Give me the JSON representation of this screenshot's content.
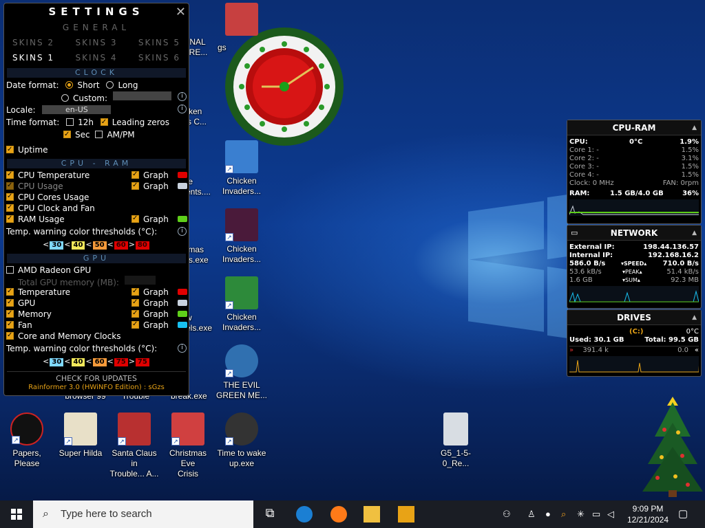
{
  "settings": {
    "title": "SETTINGS",
    "general_tab": "GENERAL",
    "skins_row1": [
      "SKINS 2",
      "SKINS 3",
      "SKINS 5"
    ],
    "skins_row2": [
      "SKINS 1",
      "SKINS 4",
      "SKINS 6"
    ],
    "clock_header": "CLOCK",
    "date_format_label": "Date format:",
    "date_short": "Short",
    "date_long": "Long",
    "date_custom": "Custom:",
    "locale_label": "Locale:",
    "locale_value": "en-US",
    "time_format_label": "Time format:",
    "time_12h": "12h",
    "time_leading_zeros": "Leading zeros",
    "time_sec": "Sec",
    "time_ampm": "AM/PM",
    "uptime": "Uptime",
    "cpu_ram_header": "CPU - RAM",
    "cpu_temperature": "CPU Temperature",
    "cpu_usage": "CPU Usage",
    "cpu_cores_usage": "CPU Cores Usage",
    "cpu_clock_fan": "CPU Clock and Fan",
    "ram_usage": "RAM Usage",
    "graph_label": "Graph",
    "temp_thresholds_label": "Temp. warning color thresholds (°C):",
    "cpu_thresholds": [
      "30",
      "40",
      "50",
      "60",
      "80"
    ],
    "gpu_header": "GPU",
    "gpu_name": "AMD Radeon GPU",
    "gpu_total_memory": "Total GPU memory (MB):",
    "gpu_temperature": "Temperature",
    "gpu_gpu": "GPU",
    "gpu_memory": "Memory",
    "gpu_fan": "Fan",
    "gpu_core_mem_clocks": "Core and Memory Clocks",
    "gpu_thresholds": [
      "30",
      "40",
      "60",
      "75",
      "75"
    ],
    "check_updates": "CHECK FOR UPDATES",
    "footer": "Rainformer 3.0 (HWiNFO Edition) : sGzs",
    "swatch_colors": {
      "cpu_temp": "#e00000",
      "cpu_usage": "#c9d2de",
      "ram_usage": "#5fcf1a",
      "gpu_temp": "#e00000",
      "gpu_gpu": "#c9d2de",
      "gpu_memory": "#5fcf1a",
      "gpu_fan": "#18c0f0"
    }
  },
  "cpu_ram_gadget": {
    "title": "CPU-RAM",
    "cpu_label": "CPU:",
    "cpu_temp": "0°C",
    "cpu_pct": "1.9%",
    "cores": [
      {
        "label": "Core 1:",
        "dash": "-",
        "value": "1.5%"
      },
      {
        "label": "Core 2:",
        "dash": "-",
        "value": "3.1%"
      },
      {
        "label": "Core 3:",
        "dash": "-",
        "value": "1.5%"
      },
      {
        "label": "Core 4:",
        "dash": "-",
        "value": "1.5%"
      }
    ],
    "clock": "Clock: 0 MHz",
    "fan": "FAN: 0rpm",
    "ram_label": "RAM:",
    "ram_value": "1.5 GB/4.0 GB",
    "ram_pct": "36%"
  },
  "network_gadget": {
    "title": "NETWORK",
    "external_ip_label": "External IP:",
    "external_ip": "198.44.136.57",
    "internal_ip_label": "Internal IP:",
    "internal_ip": "192.168.16.2",
    "down_speed": "586.0 B/s",
    "speed_label": "SPEED",
    "up_speed": "710.0 B/s",
    "down_peak": "53.6 kB/s",
    "peak_label": "PEAK",
    "up_peak": "51.4 kB/s",
    "down_sum": "1.6 GB",
    "sum_label": "SUM",
    "up_sum": "92.3 MB"
  },
  "drives_gadget": {
    "title": "DRIVES",
    "drive_label": "(C:)",
    "drive_temp": "0°C",
    "used": "Used: 30.1 GB",
    "total": "Total: 99.5 GB",
    "read": "391.4 k",
    "write": "0.0"
  },
  "desktop_icons": [
    {
      "label": "ONAL\nURE..."
    },
    {
      "label": "cken\nrs C..."
    },
    {
      "label": "te\nents...."
    },
    {
      "label": "tmas\nrs.exe"
    },
    {
      "label": "w\nels.exe"
    },
    {
      "label": "ng a\nbreak.exe"
    },
    {
      "label": "browser 99"
    },
    {
      "label": "Trouble"
    },
    {
      "label": "Chicken\nInvaders..."
    },
    {
      "label": "Chicken\nInvaders..."
    },
    {
      "label": "Chicken\nInvaders..."
    },
    {
      "label": "THE EVIL\nGREEN ME..."
    },
    {
      "label": "Papers, Please"
    },
    {
      "label": "Super Hilda"
    },
    {
      "label": "Santa Claus in\nTrouble... A..."
    },
    {
      "label": "Christmas Eve\nCrisis"
    },
    {
      "label": "Time to wake\nup.exe"
    },
    {
      "label": "G5_1-5-0_Re..."
    },
    {
      "label": "gs"
    }
  ],
  "taskbar": {
    "search_placeholder": "Type here to search",
    "time": "9:09 PM",
    "date": "12/21/2024"
  }
}
